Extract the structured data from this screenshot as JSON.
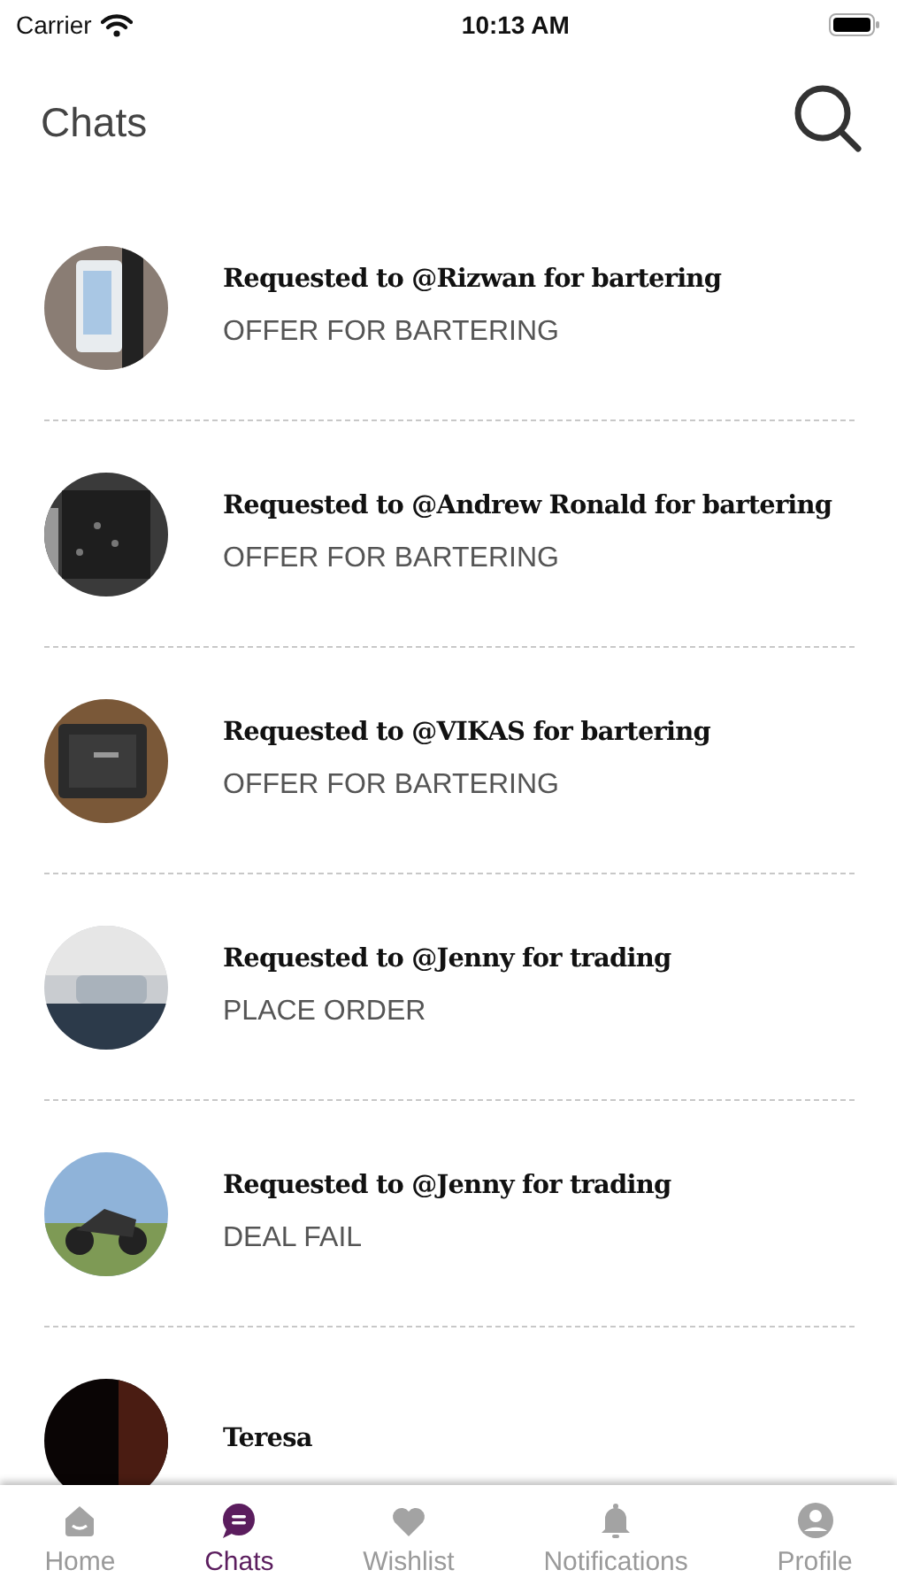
{
  "status_bar": {
    "carrier": "Carrier",
    "time": "10:13 AM"
  },
  "header": {
    "title": "Chats"
  },
  "chats": [
    {
      "title": "Requested to @Rizwan for bartering",
      "subtitle": "OFFER FOR BARTERING"
    },
    {
      "title": "Requested to @Andrew Ronald for bartering",
      "subtitle": "OFFER FOR BARTERING"
    },
    {
      "title": "Requested to @VIKAS for bartering",
      "subtitle": "OFFER FOR BARTERING"
    },
    {
      "title": "Requested to @Jenny for trading",
      "subtitle": "PLACE ORDER"
    },
    {
      "title": "Requested to @Jenny for trading",
      "subtitle": "DEAL FAIL"
    },
    {
      "title": "Teresa"
    }
  ],
  "tabs": [
    {
      "kind": "home",
      "label": "Home",
      "selected": false
    },
    {
      "kind": "chats",
      "label": "Chats",
      "selected": true
    },
    {
      "kind": "wishlist",
      "label": "Wishlist",
      "selected": false
    },
    {
      "kind": "notifications",
      "label": "Notifications",
      "selected": false
    },
    {
      "kind": "profile",
      "label": "Profile",
      "selected": false
    }
  ]
}
